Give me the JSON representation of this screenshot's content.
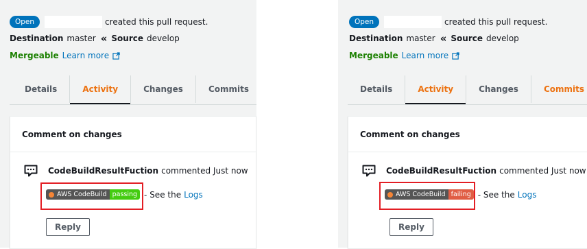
{
  "panels": [
    {
      "status_badge": "Open",
      "created_text": "created this pull request.",
      "destination_label": "Destination",
      "destination_branch": "master",
      "source_label": "Source",
      "source_branch": "develop",
      "mergeable_text": "Mergeable",
      "learn_more": "Learn more",
      "tabs": [
        "Details",
        "Activity",
        "Changes",
        "Commits"
      ],
      "active_tab": "Activity",
      "card_title": "Comment on changes",
      "commenter": "CodeBuildResultFuction",
      "commented_text": "commented Just now",
      "badge_label": "AWS CodeBuild",
      "badge_status": "passing",
      "badge_status_color": "#4c1",
      "see_the": "- See the",
      "logs_link": "Logs",
      "reply_button": "Reply"
    },
    {
      "status_badge": "Open",
      "created_text": "created this pull request.",
      "destination_label": "Destination",
      "destination_branch": "master",
      "source_label": "Source",
      "source_branch": "develop",
      "mergeable_text": "Mergeable",
      "learn_more": "Learn more",
      "tabs": [
        "Details",
        "Activity",
        "Changes",
        "Commits"
      ],
      "active_tab": "Activity",
      "card_title": "Comment on changes",
      "commenter": "CodeBuildResultFuction",
      "commented_text": "commented Just now",
      "badge_label": "AWS CodeBuild",
      "badge_status": "failing",
      "badge_status_color": "#e05d44",
      "see_the": "- See the",
      "logs_link": "Logs",
      "reply_button": "Reply"
    }
  ],
  "colors": {
    "accent": "#ec7211",
    "link": "#0073bb",
    "mergeable": "#1d8102",
    "highlight": "#e31e24"
  }
}
